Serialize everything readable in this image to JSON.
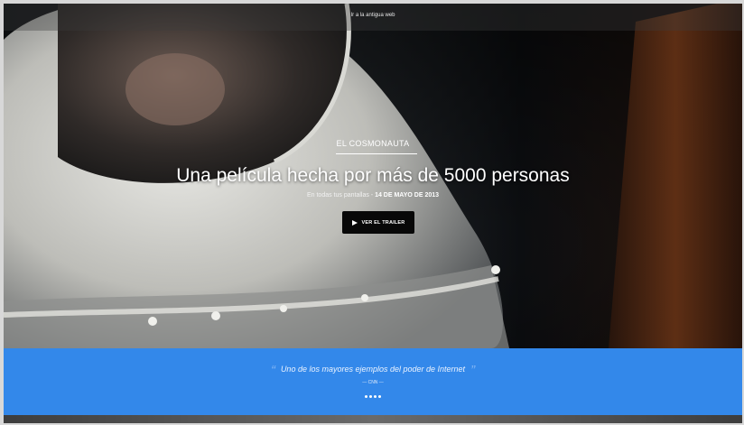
{
  "topbar": {
    "link_label": "Ir a la antigua web"
  },
  "hero": {
    "kicker": "EL COSMONAUTA",
    "headline": "Una película hecha por más de 5000 personas",
    "subline_prefix": "En todas tus pantallas - ",
    "release_date": "14 DE MAYO DE 2013",
    "trailer_button_label": "VER EL TRAILER",
    "image": "astronaut-helmet-photo"
  },
  "quote_band": {
    "open_mark": "“",
    "quote": "Uno de los mayores ejemplos del poder de Internet",
    "close_mark": "”",
    "source": "— CNN —",
    "slide_count": 4,
    "background_color": "#3388ea"
  },
  "icons": {
    "trailer": "play-icon"
  }
}
